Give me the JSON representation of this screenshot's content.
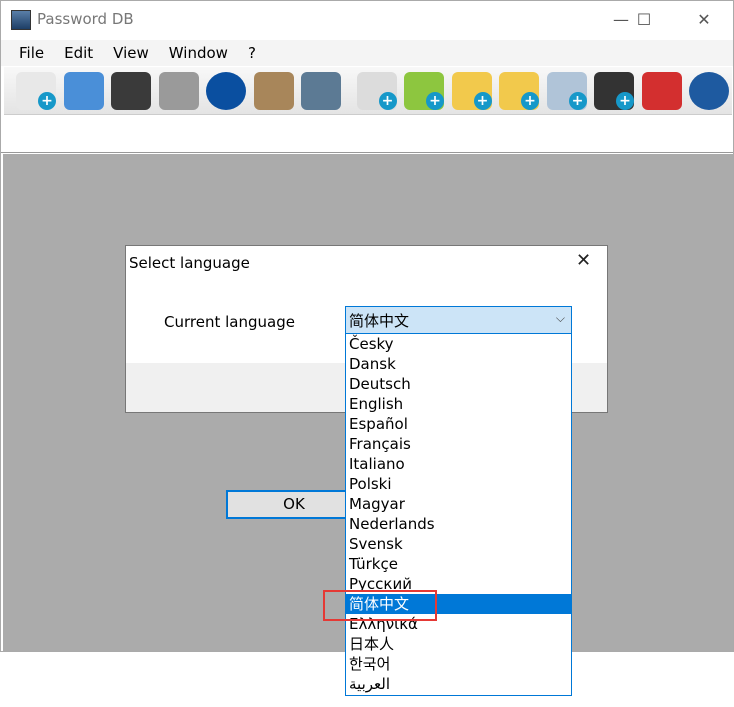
{
  "window": {
    "title": "Password DB",
    "minimize": "—",
    "maximize": "☐",
    "close": "✕"
  },
  "menu": [
    "File",
    "Edit",
    "View",
    "Window",
    "?"
  ],
  "toolbar": [
    {
      "name": "new-database-icon",
      "color": "#e8e8e8",
      "plus": true
    },
    {
      "name": "open-database-icon",
      "color": "#4a8fd8",
      "plus": false
    },
    {
      "name": "save-icon",
      "color": "#3a3a3a",
      "plus": false
    },
    {
      "name": "print-icon",
      "color": "#9a9a9a",
      "plus": false
    },
    {
      "name": "info-icon",
      "color": "#0a4fa0",
      "plus": false
    },
    {
      "name": "search-icon",
      "color": "#a8865a",
      "plus": false
    },
    {
      "name": "settings-icon",
      "color": "#5c7a94",
      "plus": false
    },
    {
      "name": "add-entry-icon",
      "color": "#dcdcdc",
      "plus": true
    },
    {
      "name": "add-key-icon",
      "color": "#8dc63f",
      "plus": true
    },
    {
      "name": "add-folder-icon",
      "color": "#f2c94c",
      "plus": true
    },
    {
      "name": "add-subfolder-icon",
      "color": "#f2c94c",
      "plus": true
    },
    {
      "name": "add-link-icon",
      "color": "#b0c4d8",
      "plus": true
    },
    {
      "name": "add-table-icon",
      "color": "#333333",
      "plus": true
    },
    {
      "name": "delete-icon",
      "color": "#d32f2f",
      "plus": false
    },
    {
      "name": "back-icon",
      "color": "#1e5aa0",
      "plus": false
    }
  ],
  "dialog": {
    "title": "Select language",
    "close": "✕",
    "current_label": "Current language",
    "selected": "简体中文",
    "ok": "OK",
    "arrow": "⌵"
  },
  "languages": [
    "Česky",
    "Dansk",
    "Deutsch",
    "English",
    "Español",
    "Français",
    "Italiano",
    "Polski",
    "Magyar",
    "Nederlands",
    "Svensk",
    "Türkçe",
    "Русский",
    "简体中文",
    "Ελληνικά",
    "日本人",
    "한국어",
    "العربية"
  ],
  "selected_index": 13
}
